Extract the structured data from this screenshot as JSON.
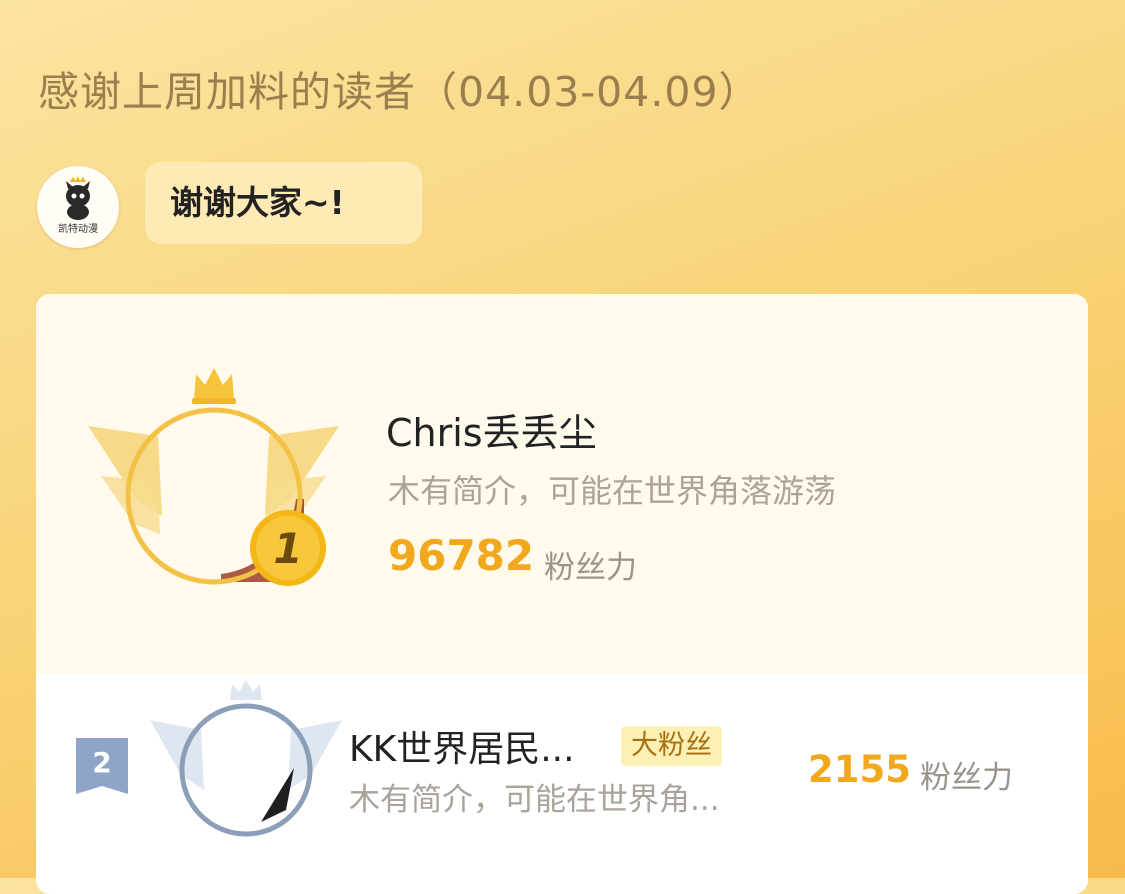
{
  "header": {
    "title": "感谢上周加料的读者（04.03-04.09）"
  },
  "author": {
    "avatar_caption": "凯特动漫",
    "message": "谢谢大家~!"
  },
  "ranking": [
    {
      "rank": "1",
      "name": "Chris丢丢尘",
      "bio": "木有简介，可能在世界角落游荡",
      "score": "96782",
      "score_unit": "粉丝力"
    },
    {
      "rank": "2",
      "name": "KK世界居民...",
      "tag": "大粉丝",
      "bio": "木有简介，可能在世界角...",
      "score": "2155",
      "score_unit": "粉丝力"
    }
  ],
  "colors": {
    "accent": "#f2a81d",
    "card_top": "#fffaec",
    "rank2_frame": "#8c9fb8"
  }
}
